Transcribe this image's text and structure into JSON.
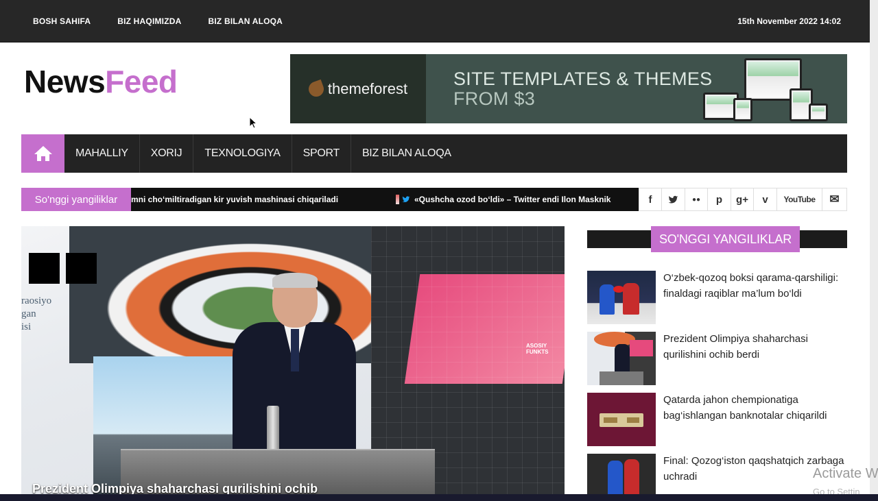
{
  "topbar": {
    "links": [
      "BOSH SAHIFA",
      "BIZ HAQIMIZDA",
      "BIZ BILAN ALOQA"
    ],
    "datetime": "15th November 2022 14:02"
  },
  "logo": {
    "part1": "News",
    "part2": "Feed"
  },
  "banner": {
    "brand": "themeforest",
    "headline": "SITE TEMPLATES & THEMES",
    "subline": "FROM $3"
  },
  "nav": {
    "home_icon": "home-icon",
    "items": [
      "MAHALLIY",
      "XORIJ",
      "TEXNOLOGIYA",
      "SPORT",
      "BIZ BILAN ALOQA"
    ]
  },
  "ticker": {
    "label": "So'nggi yangiliklar",
    "messages": [
      "mni cho‘miltiradigan kir yuvish mashinasi chiqariladi",
      "«Qushcha ozod bo‘ldi» – Twitter endi Ilon Masknik"
    ]
  },
  "social": {
    "items": [
      {
        "name": "facebook-icon",
        "glyph": "f"
      },
      {
        "name": "twitter-icon",
        "glyph": "t"
      },
      {
        "name": "flickr-icon",
        "glyph": "●●"
      },
      {
        "name": "pinterest-icon",
        "glyph": "p"
      },
      {
        "name": "googleplus-icon",
        "glyph": "g+"
      },
      {
        "name": "vimeo-icon",
        "glyph": "v"
      },
      {
        "name": "youtube-icon",
        "glyph": "YouTube"
      },
      {
        "name": "mail-icon",
        "glyph": "✉"
      }
    ]
  },
  "hero": {
    "side_text": [
      "raosiyo",
      "gan",
      "isi"
    ],
    "sign_text": "ASOSIY FUNKTS",
    "caption": "Prezident Olimpiya shaharchasi qurilishini ochib"
  },
  "sidebar": {
    "heading": "SO'NGGI YANGILIKLAR",
    "items": [
      {
        "title": "O‘zbek-qozoq boksi qarama-qarshiligi: finaldagi raqiblar ma’lum bo‘ldi"
      },
      {
        "title": "Prezident Olimpiya shaharchasi qurilishini ochib berdi"
      },
      {
        "title": "Qatarda jahon chempionatiga bag‘ishlangan banknotalar chiqarildi"
      },
      {
        "title": "Final: Qozog‘iston qaqshatqich zarbaga uchradi"
      }
    ]
  },
  "watermark": {
    "title": "Activate W",
    "subtitle": "Go to Settin"
  },
  "colors": {
    "accent": "#c56fcd",
    "dark": "#232323",
    "topbar": "#272727"
  }
}
